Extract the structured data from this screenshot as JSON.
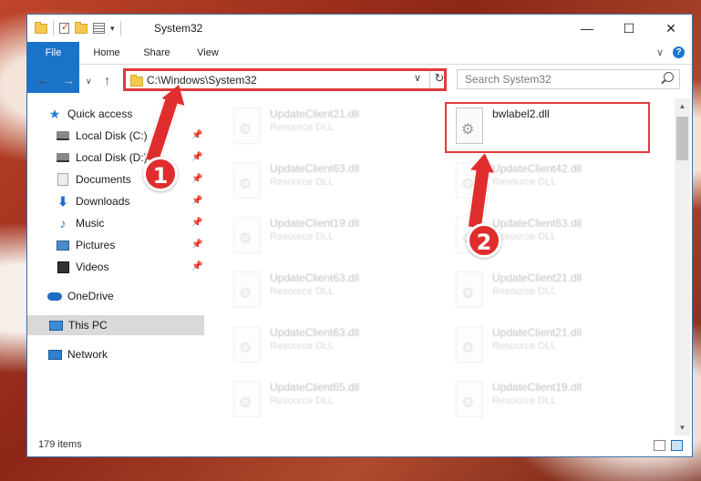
{
  "window": {
    "title": "System32"
  },
  "ribbon": {
    "tabs": [
      "File",
      "Home",
      "Share",
      "View"
    ]
  },
  "nav": {
    "address": "C:\\Windows\\System32",
    "search_placeholder": "Search System32"
  },
  "sidebar": {
    "items": [
      {
        "label": "Quick access",
        "icon": "star-icon"
      },
      {
        "label": "Local Disk (C:)",
        "icon": "disk-icon",
        "pinned": true
      },
      {
        "label": "Local Disk (D:)",
        "icon": "disk-icon",
        "pinned": true
      },
      {
        "label": "Documents",
        "icon": "documents-icon",
        "pinned": true
      },
      {
        "label": "Downloads",
        "icon": "download-icon",
        "pinned": true
      },
      {
        "label": "Music",
        "icon": "music-icon",
        "pinned": true
      },
      {
        "label": "Pictures",
        "icon": "pictures-icon",
        "pinned": true
      },
      {
        "label": "Videos",
        "icon": "videos-icon",
        "pinned": true
      },
      {
        "label": "OneDrive",
        "icon": "cloud-icon"
      },
      {
        "label": "This PC",
        "icon": "computer-icon",
        "selected": true
      },
      {
        "label": "Network",
        "icon": "network-icon"
      }
    ]
  },
  "files": {
    "highlighted": {
      "name": "bwlabel2.dll"
    },
    "left_column": [
      {
        "name": "UpdateClient21.dll",
        "type": "Resource DLL"
      },
      {
        "name": "UpdateClient63.dll",
        "type": "Resource DLL"
      },
      {
        "name": "UpdateClient19.dll",
        "type": "Resource DLL"
      },
      {
        "name": "UpdateClient63.dll",
        "type": "Resource DLL"
      },
      {
        "name": "UpdateClient63.dll",
        "type": "Resource DLL"
      },
      {
        "name": "UpdateClient65.dll",
        "type": "Resource DLL"
      }
    ],
    "right_column": [
      {
        "name": "UpdateClient42.dll",
        "type": "Resource DLL"
      },
      {
        "name": "UpdateClient63.dll",
        "type": "Resource DLL"
      },
      {
        "name": "UpdateClient21.dll",
        "type": "Resource DLL"
      },
      {
        "name": "UpdateClient21.dll",
        "type": "Resource DLL"
      },
      {
        "name": "UpdateClient19.dll",
        "type": "Resource DLL"
      }
    ]
  },
  "status": {
    "item_count": "179 items"
  },
  "callouts": [
    "1",
    "2"
  ],
  "colors": {
    "accent": "#1a73c8",
    "callout": "#e02e2e"
  }
}
